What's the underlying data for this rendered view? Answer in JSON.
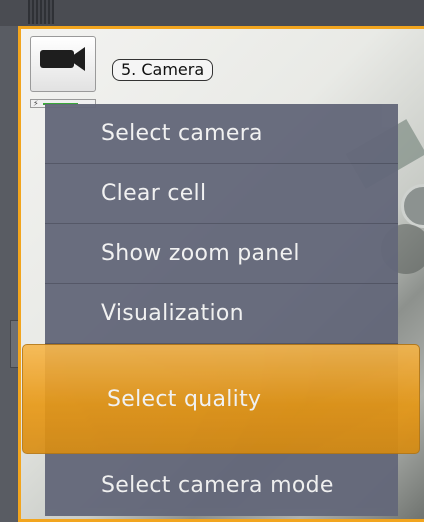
{
  "camera_cell": {
    "camera_name": "5. Camera",
    "camera_icon": "camera-icon",
    "signal_icon": "signal-icon",
    "signal_level": 0.7,
    "highlight_color": "#f2a51e"
  },
  "context_menu": {
    "items": [
      {
        "label": "Select camera"
      },
      {
        "label": "Clear cell"
      },
      {
        "label": "Show zoom panel"
      },
      {
        "label": "Visualization"
      },
      {
        "label": "Select quality"
      },
      {
        "label": "Select camera mode"
      }
    ],
    "active_index": 4,
    "background_color": "#64687a",
    "active_color": "#f2a51e"
  }
}
